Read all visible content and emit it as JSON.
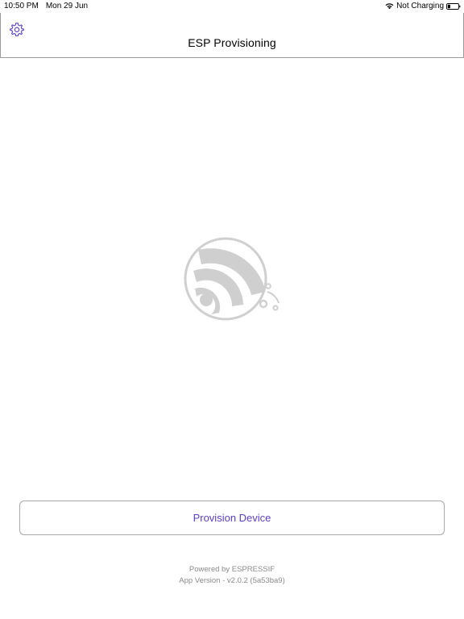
{
  "status_bar": {
    "time": "10:50 PM",
    "date": "Mon 29 Jun",
    "battery_status": "Not Charging",
    "wifi_icon": "wifi-icon",
    "battery_icon": "battery-icon",
    "battery_level": 0.25
  },
  "nav": {
    "title": "ESP Provisioning",
    "settings_icon": "gear-icon"
  },
  "main": {
    "logo_icon": "espressif-logo",
    "provision_button_label": "Provision Device"
  },
  "footer": {
    "powered_by": "Powered by ESPRESSIF",
    "app_version": "App Version - v2.0.2 (5a53ba9)"
  },
  "colors": {
    "accent": "#5b3fc4",
    "logo_gray": "#cfcfcf",
    "footer_text": "#8a8a8a"
  }
}
